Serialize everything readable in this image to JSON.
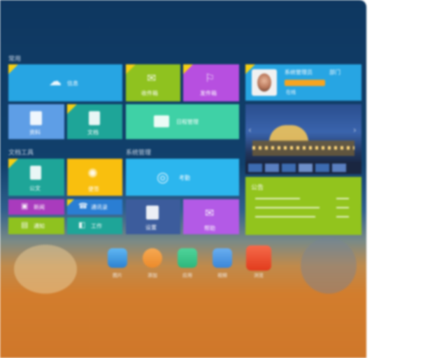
{
  "sections": {
    "top_title": "常用",
    "bottom_left_title": "文档工具",
    "bottom_right_title": "系统管理"
  },
  "tiles": {
    "cloud": "信息",
    "top_green": "收件箱",
    "top_purple": "发件箱",
    "sky_doc": "资料",
    "teal_doc": "文档",
    "mint": "日程管理",
    "bl_teal": "公文",
    "bl_yellow": "便签",
    "bl_purple_small": "新闻",
    "bl_blue_small": "通讯录",
    "bl_lime_small": "通知",
    "bl_teal_small": "工作",
    "br_sky": "考勤",
    "br_navy": "设置",
    "br_violet": "帮助"
  },
  "profile": {
    "name": "系统管理员",
    "dept": "部门",
    "status": "在线"
  },
  "photo": {
    "alt": "夜景"
  },
  "notice": {
    "title": "公告",
    "items": [
      "",
      "",
      ""
    ]
  },
  "dock": [
    "图片",
    "添加",
    "应用",
    "视频",
    "浏览"
  ],
  "colors": {
    "cyan": "#27a5e3",
    "lime": "#8fc21f",
    "purple": "#b74fe0",
    "sky": "#5e9ee6",
    "teal": "#1ea598",
    "mint": "#3fd1a6",
    "yellow": "#f9bf0e",
    "navy": "#3c5c9c",
    "violet": "#b35ae6",
    "green_panel": "#92c41d",
    "badge": "#f4cf15"
  }
}
